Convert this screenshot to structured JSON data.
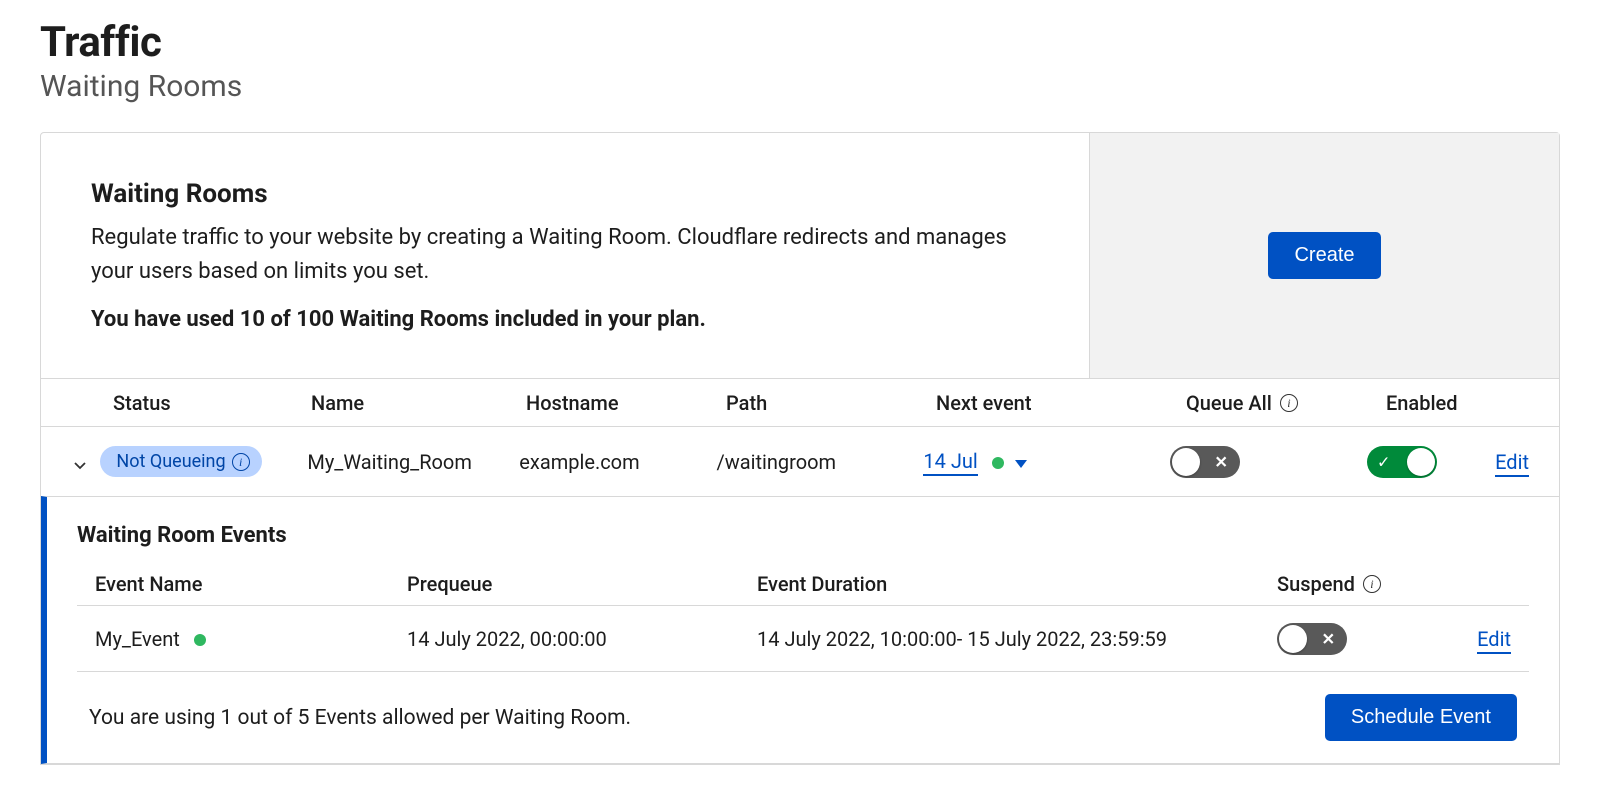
{
  "page": {
    "title": "Traffic",
    "subtitle": "Waiting Rooms"
  },
  "card": {
    "title": "Waiting Rooms",
    "description": "Regulate traffic to your website by creating a Waiting Room. Cloudflare redirects and manages your users based on limits you set.",
    "usage": "You have used 10 of 100 Waiting Rooms included in your plan.",
    "create_label": "Create"
  },
  "table": {
    "headers": {
      "status": "Status",
      "name": "Name",
      "hostname": "Hostname",
      "path": "Path",
      "next_event": "Next event",
      "queue_all": "Queue All",
      "enabled": "Enabled"
    },
    "row": {
      "status_label": "Not Queueing",
      "name": "My_Waiting_Room",
      "hostname": "example.com",
      "path": "/waitingroom",
      "next_event": "14 Jul",
      "queue_all_on": false,
      "enabled_on": true,
      "edit_label": "Edit"
    }
  },
  "events": {
    "title": "Waiting Room Events",
    "headers": {
      "event_name": "Event Name",
      "prequeue": "Prequeue",
      "duration": "Event Duration",
      "suspend": "Suspend"
    },
    "row": {
      "name": "My_Event",
      "prequeue": "14 July 2022, 00:00:00",
      "duration": "14 July 2022, 10:00:00- 15 July 2022, 23:59:59",
      "suspend_on": false,
      "edit_label": "Edit"
    },
    "footer_text": "You are using 1 out of 5 Events allowed per Waiting Room.",
    "schedule_label": "Schedule Event"
  },
  "glyphs": {
    "x": "✕",
    "check": "✓"
  }
}
